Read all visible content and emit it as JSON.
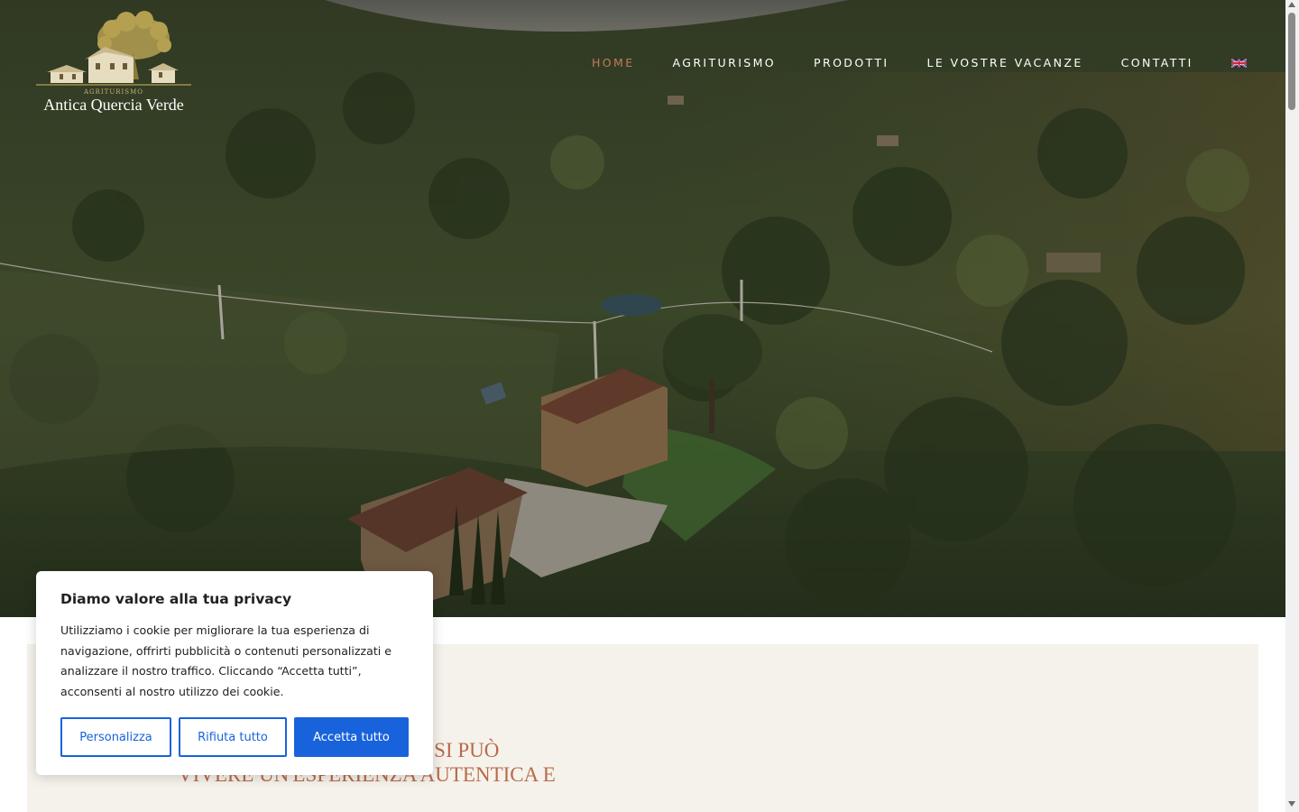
{
  "brand": {
    "subtitle": "AGRITURISMO",
    "name": "Antica Quercia Verde"
  },
  "nav": {
    "items": [
      "HOME",
      "AGRITURISMO",
      "PRODOTTI",
      "LE VOSTRE VACANZE",
      "CONTATTI"
    ],
    "active": "HOME",
    "language_icon": "uk-flag-icon"
  },
  "content": {
    "headline": "RTONA È IL LUOGO DOVE SI PUÒ VIVERE UN'ESPERIENZA AUTENTICA E"
  },
  "cookie_banner": {
    "title": "Diamo valore alla tua privacy",
    "text": "Utilizziamo i cookie per migliorare la tua esperienza di navigazione, offrirti pubblicità o contenuti personalizzati e analizzare il nostro traffico. Cliccando “Accetta tutti”, acconsenti al nostro utilizzo dei cookie.",
    "buttons": {
      "customize": "Personalizza",
      "reject": "Rifiuta tutto",
      "accept": "Accetta tutto"
    }
  },
  "colors": {
    "accent": "#c47a5a",
    "headline": "#b86a4a",
    "primary_button": "#1863dc",
    "section_bg": "#f5f2eb"
  }
}
